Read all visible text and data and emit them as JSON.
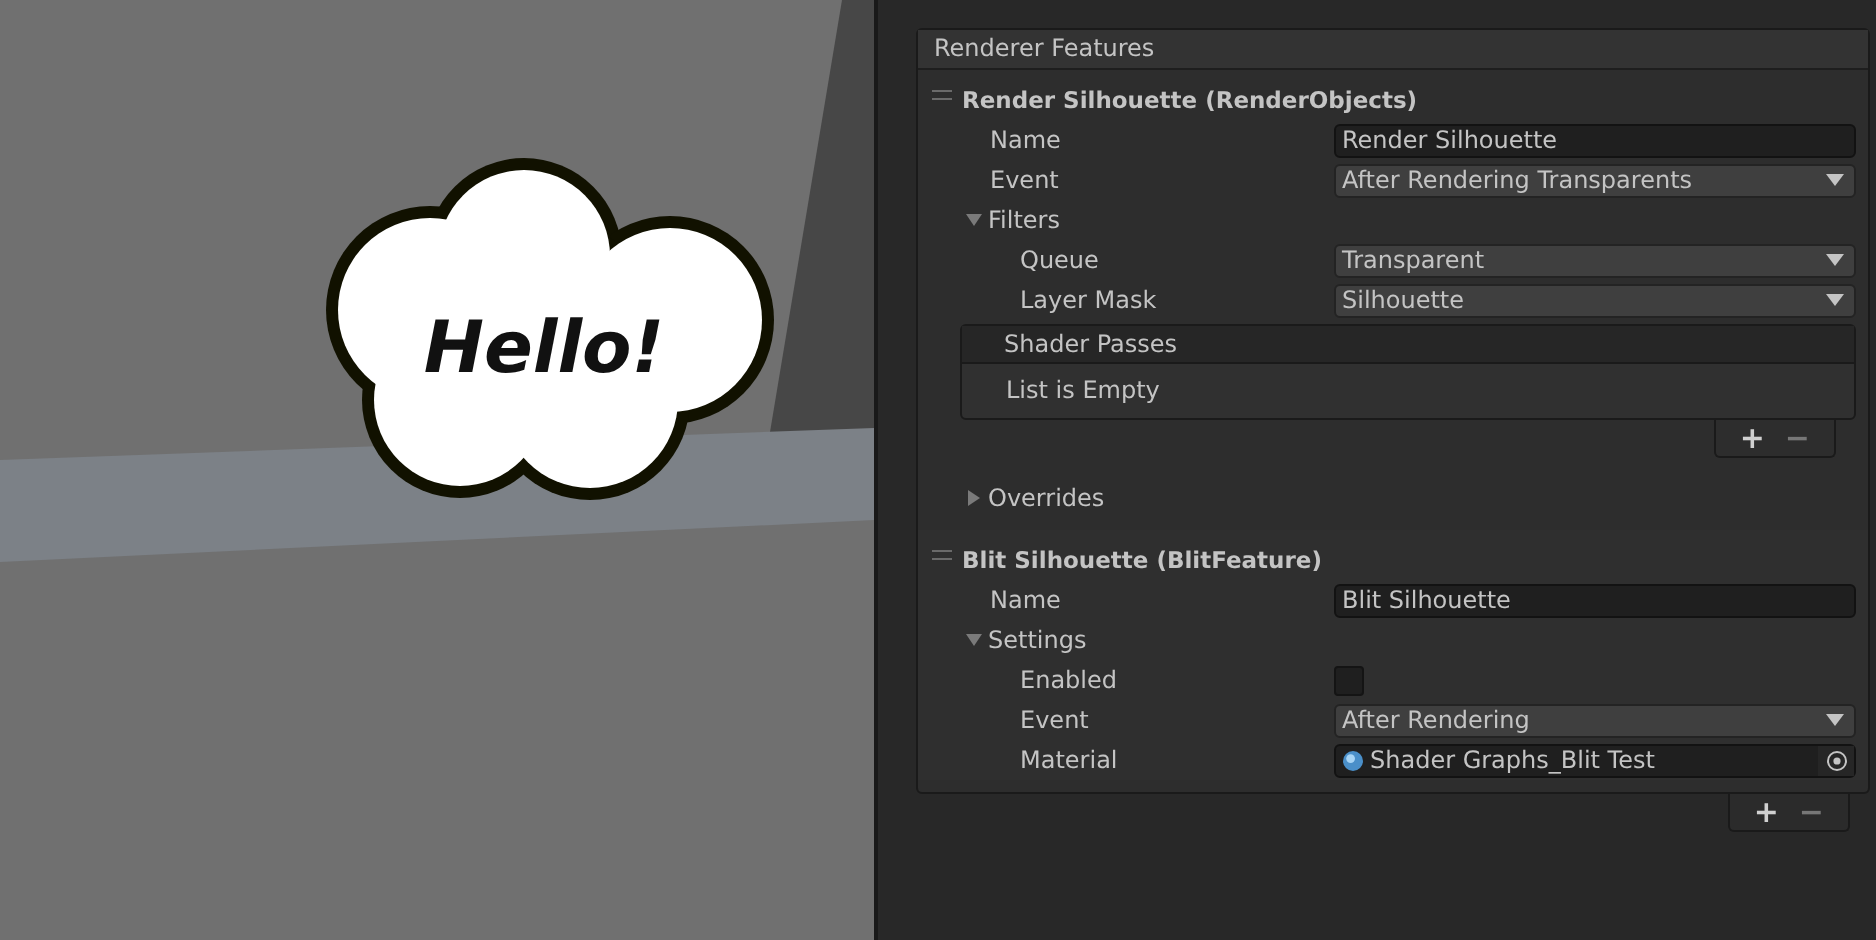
{
  "scene": {
    "bubble_text": "Hello!"
  },
  "renderer_features": {
    "title": "Renderer Features",
    "features": [
      {
        "title": "Render Silhouette (RenderObjects)",
        "rows": [
          {
            "kind": "text",
            "label": "Name",
            "value": "Render Silhouette"
          },
          {
            "kind": "dropdown",
            "label": "Event",
            "value": "After Rendering Transparents"
          },
          {
            "kind": "foldout",
            "label": "Filters",
            "expanded": true,
            "children": [
              {
                "kind": "dropdown",
                "label": "Queue",
                "value": "Transparent"
              },
              {
                "kind": "dropdown",
                "label": "Layer Mask",
                "value": "Silhouette"
              }
            ]
          },
          {
            "kind": "list",
            "title": "Shader Passes",
            "empty_text": "List is Empty",
            "buttons": [
              "+",
              "−"
            ]
          },
          {
            "kind": "foldout",
            "label": "Overrides",
            "expanded": false
          }
        ]
      },
      {
        "title": "Blit Silhouette (BlitFeature)",
        "rows": [
          {
            "kind": "text",
            "label": "Name",
            "value": "Blit Silhouette"
          },
          {
            "kind": "foldout",
            "label": "Settings",
            "expanded": true,
            "children": [
              {
                "kind": "checkbox",
                "label": "Enabled",
                "checked": false
              },
              {
                "kind": "dropdown",
                "label": "Event",
                "value": "After Rendering"
              },
              {
                "kind": "object",
                "label": "Material",
                "value": "Shader Graphs_Blit Test"
              }
            ]
          }
        ]
      }
    ],
    "buttons": [
      "+",
      "−"
    ]
  }
}
